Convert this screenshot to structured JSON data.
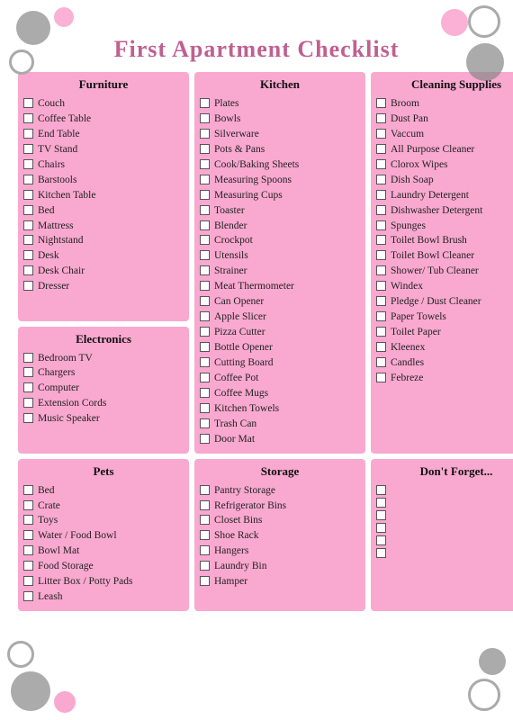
{
  "title": "First Apartment Checklist",
  "sections": {
    "furniture": {
      "label": "Furniture",
      "items": [
        "Couch",
        "Coffee Table",
        "End Table",
        "TV Stand",
        "Chairs",
        "Barstools",
        "Kitchen Table",
        "Bed",
        "Mattress",
        "Nightstand",
        "Desk",
        "Desk Chair",
        "Dresser"
      ]
    },
    "electronics": {
      "label": "Electronics",
      "items": [
        "Bedroom TV",
        "Chargers",
        "Computer",
        "Extension Cords",
        "Music Speaker"
      ]
    },
    "pets": {
      "label": "Pets",
      "items": [
        "Bed",
        "Crate",
        "Toys",
        "Water / Food Bowl",
        "Bowl Mat",
        "Food Storage",
        "Litter Box / Potty Pads",
        "Leash"
      ]
    },
    "kitchen": {
      "label": "Kitchen",
      "items": [
        "Plates",
        "Bowls",
        "Silverware",
        "Pots & Pans",
        "Cook/Baking Sheets",
        "Measuring Spoons",
        "Measuring Cups",
        "Toaster",
        "Blender",
        "Crockpot",
        "Utensils",
        "Strainer",
        "Meat Thermometer",
        "Can Opener",
        "Apple Slicer",
        "Pizza Cutter",
        "Bottle Opener",
        "Cutting Board",
        "Coffee Pot",
        "Coffee Mugs",
        "Kitchen Towels",
        "Trash Can",
        "Door Mat"
      ]
    },
    "storage": {
      "label": "Storage",
      "items": [
        "Pantry Storage",
        "Refrigerator Bins",
        "Closet Bins",
        "Shoe Rack",
        "Hangers",
        "Laundry Bin",
        "Hamper"
      ]
    },
    "cleaning": {
      "label": "Cleaning Supplies",
      "items": [
        "Broom",
        "Dust Pan",
        "Vaccum",
        "All Purpose Cleaner",
        "Clorox Wipes",
        "Dish Soap",
        "Laundry Detergent",
        "Dishwasher Detergent",
        "Spunges",
        "Toilet Bowl Brush",
        "Toilet Bowl Cleaner",
        "Shower/ Tub Cleaner",
        "Windex",
        "Pledge / Dust Cleaner",
        "Paper Towels",
        "Toilet Paper",
        "Kleenex",
        "Candles",
        "Febreze"
      ]
    },
    "dont_forget": {
      "label": "Don't Forget...",
      "items": [
        "",
        "",
        "",
        "",
        "",
        ""
      ]
    }
  }
}
